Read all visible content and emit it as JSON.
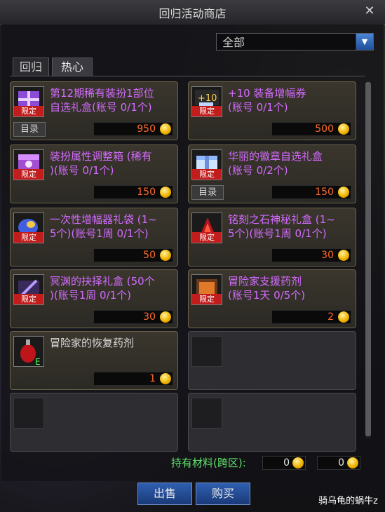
{
  "window": {
    "title": "回归活动商店",
    "close_icon": "close-icon"
  },
  "filter": {
    "selected": "全部"
  },
  "tabs": [
    {
      "label": "回归"
    },
    {
      "label": "热心"
    }
  ],
  "items": [
    {
      "name": "第12期稀有装扮1部位\n自选礼盒(账号 0/1个)",
      "price": "950",
      "limit": "限定",
      "catalog": "目录",
      "color": "purple",
      "icon": "purple-gift-box-icon"
    },
    {
      "name": "+10 装备增幅券\n(账号 0/1个)",
      "price": "500",
      "limit": "限定",
      "color": "purple",
      "icon": "amplify-ticket-icon"
    },
    {
      "name": "装扮属性调整箱 (稀有\n)(账号 0/1个)",
      "price": "150",
      "limit": "限定",
      "color": "purple",
      "icon": "avatar-adjust-box-icon"
    },
    {
      "name": "华丽的徽章自选礼盒\n(账号 0/2个)",
      "price": "150",
      "limit": "限定",
      "catalog": "目录",
      "color": "purple",
      "icon": "emblem-box-icon"
    },
    {
      "name": "一次性增幅器礼袋 (1~\n5个)(账号1周 0/1个)",
      "price": "50",
      "limit": "限定",
      "color": "purple",
      "icon": "amplifier-bag-icon"
    },
    {
      "name": "铭刻之石神秘礼盒 (1~\n5个)(账号1周 0/1个)",
      "price": "30",
      "limit": "限定",
      "color": "purple",
      "icon": "inscription-stone-box-icon"
    },
    {
      "name": "冥渊的抉择礼盒 (50个\n)(账号1周 0/1个)",
      "price": "30",
      "limit": "限定",
      "color": "purple",
      "icon": "abyss-choice-box-icon"
    },
    {
      "name": "冒险家支援药剂\n(账号1天 0/5个)",
      "price": "2",
      "limit": "限定",
      "color": "purple",
      "icon": "support-potion-icon"
    },
    {
      "name": "冒险家的恢复药剂",
      "price": "1",
      "limit": "",
      "color": "white",
      "icon": "recovery-potion-icon"
    }
  ],
  "materials": {
    "label": "持有材料(跨区):",
    "value1": "0",
    "value2": "0"
  },
  "buttons": {
    "sell": "出售",
    "buy": "购买"
  },
  "watermark": "骑乌龟的蜗牛z",
  "colors": {
    "price": "#ff6a2a",
    "purple_text": "#d46bff",
    "limit_badge": "#c21d1d",
    "materials_text": "#5fe06a"
  }
}
